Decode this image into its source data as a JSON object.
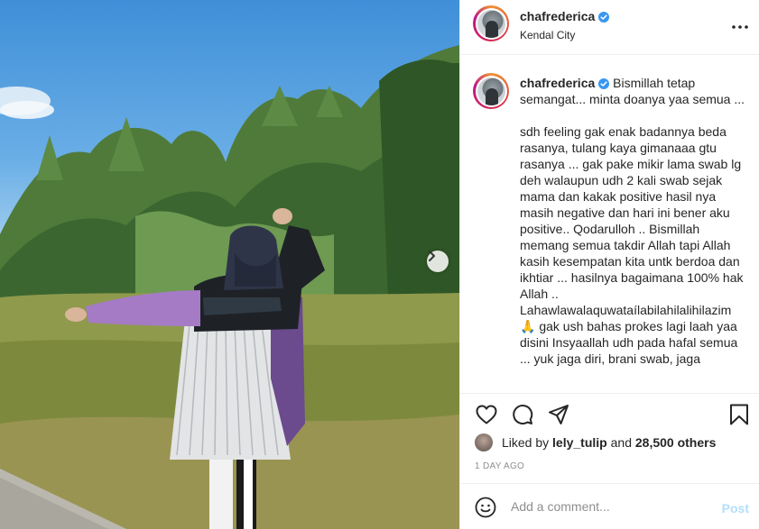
{
  "post": {
    "username": "chafrederica",
    "location": "Kendal City",
    "caption": "Bismillah tetap semangat... minta doanya yaa semua ...\n\nsdh feeling gak enak badannya beda rasanya, tulang kaya gimanaaa gtu rasanya ... gak pake mikir lama swab lg deh walaupun udh 2 kali swab sejak mama dan kakak positive hasil nya masih negative dan hari ini bener aku positive.. Qodarulloh .. Bismillah memang semua takdir Allah tapi Allah kasih kesempatan kita untk berdoa dan ikhtiar ... hasilnya bagaimana 100% hak Allah .. Lahawlawalaquwataílabilahilalihilazim 🙏 gak ush bahas prokes lagi laah yaa disini Insyaallah udh pada hafal semua ... yuk jaga diri, brani swab, jaga",
    "liked_by_prefix": "Liked by",
    "liked_by_user": "lely_tulip",
    "liked_by_and": "and",
    "likes_others": "28,500 others",
    "time_ago": "1 DAY AGO"
  },
  "comment": {
    "placeholder": "Add a comment...",
    "post_label": "Post"
  },
  "icons": {
    "verified": "verified-badge-icon",
    "more": "more-options-icon",
    "like": "heart-icon",
    "comment": "comment-icon",
    "share": "share-icon",
    "save": "bookmark-icon",
    "emoji": "emoji-icon",
    "next": "chevron-right-icon"
  },
  "colors": {
    "verified_blue": "#3897f0",
    "post_disabled": "#b2dffc",
    "muted": "#8e8e8e"
  }
}
